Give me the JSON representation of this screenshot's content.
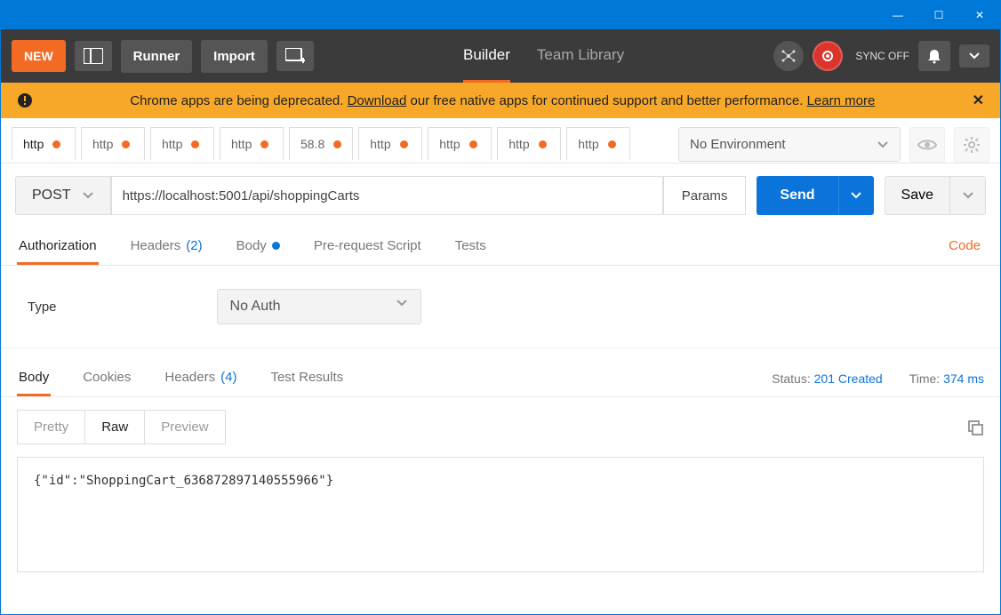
{
  "titlebar": {
    "minimize": "—",
    "maximize": "☐",
    "close": "✕"
  },
  "topbar": {
    "new_label": "NEW",
    "runner_label": "Runner",
    "import_label": "Import",
    "tab_builder": "Builder",
    "tab_library": "Team Library",
    "sync_label": "SYNC OFF"
  },
  "banner": {
    "prefix": "Chrome apps are being deprecated. ",
    "download": "Download",
    "mid": " our free native apps for continued support and better performance. ",
    "learn": "Learn more",
    "close": "✕"
  },
  "env": {
    "selected": "No Environment"
  },
  "request_tabs": [
    {
      "label": "http"
    },
    {
      "label": "http"
    },
    {
      "label": "http"
    },
    {
      "label": "http"
    },
    {
      "label": "58.8"
    },
    {
      "label": "http"
    },
    {
      "label": "http"
    },
    {
      "label": "http"
    },
    {
      "label": "http"
    }
  ],
  "request": {
    "method": "POST",
    "url": "https://localhost:5001/api/shoppingCarts",
    "params_label": "Params",
    "send_label": "Send",
    "save_label": "Save"
  },
  "config_tabs": {
    "authorization": "Authorization",
    "headers": "Headers",
    "headers_count": "(2)",
    "body": "Body",
    "prerequest": "Pre-request Script",
    "tests": "Tests",
    "code": "Code"
  },
  "auth": {
    "type_label": "Type",
    "selected": "No Auth"
  },
  "response_tabs": {
    "body": "Body",
    "cookies": "Cookies",
    "headers": "Headers",
    "headers_count": "(4)",
    "tests": "Test Results"
  },
  "status": {
    "status_label": "Status:",
    "status_val": "201 Created",
    "time_label": "Time:",
    "time_val": "374 ms"
  },
  "view": {
    "pretty": "Pretty",
    "raw": "Raw",
    "preview": "Preview"
  },
  "response_body": "{\"id\":\"ShoppingCart_636872897140555966\"}"
}
